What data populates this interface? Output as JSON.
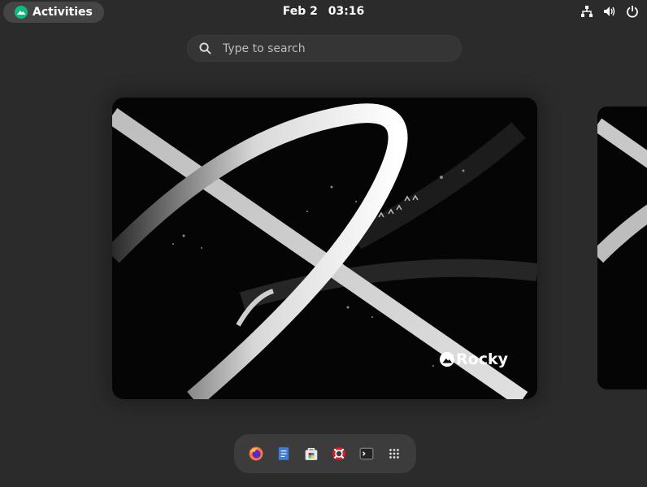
{
  "topbar": {
    "activities_label": "Activities",
    "date": "Feb 2",
    "time": "03:16",
    "tray_icons": [
      "network-icon",
      "volume-icon",
      "power-icon"
    ]
  },
  "search": {
    "placeholder": "Type to search"
  },
  "workspace": {
    "wallpaper_brand": "Rocky"
  },
  "dash": {
    "apps": [
      "firefox-icon",
      "text-editor-icon",
      "software-icon",
      "help-icon",
      "terminal-icon",
      "app-grid-icon"
    ]
  },
  "colors": {
    "background": "#2b2b2b",
    "panel_pill": "#454545",
    "dash": "#3c3c3c",
    "rocky_green": "#10b981"
  }
}
